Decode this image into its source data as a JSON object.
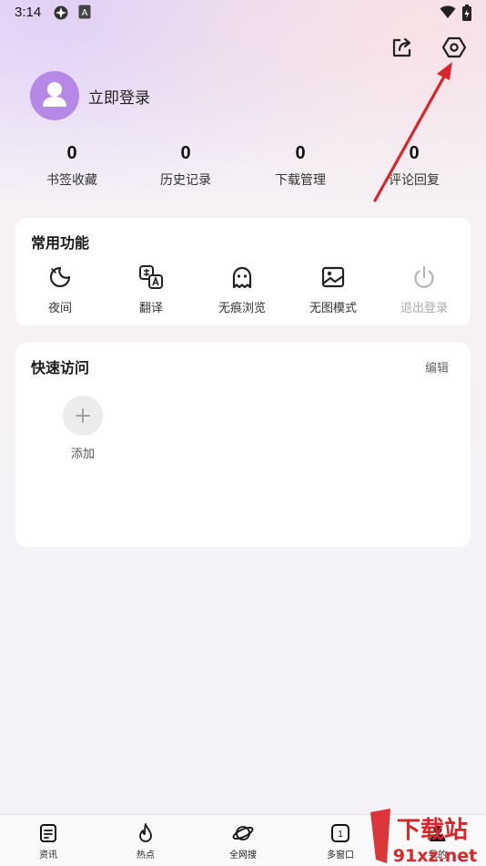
{
  "status_bar": {
    "time": "3:14",
    "icons": [
      "app-icon",
      "a-icon",
      "wifi-icon",
      "battery-icon"
    ]
  },
  "header": {
    "icons": [
      "share-icon",
      "settings-icon"
    ]
  },
  "profile": {
    "login_label": "立即登录"
  },
  "stats": [
    {
      "value": "0",
      "label": "书签收藏"
    },
    {
      "value": "0",
      "label": "历史记录"
    },
    {
      "value": "0",
      "label": "下载管理"
    },
    {
      "value": "0",
      "label": "评论回复"
    }
  ],
  "common_functions": {
    "title": "常用功能",
    "items": [
      {
        "label": "夜间",
        "icon": "moon-icon"
      },
      {
        "label": "翻译",
        "icon": "translate-icon"
      },
      {
        "label": "无痕浏览",
        "icon": "ghost-icon"
      },
      {
        "label": "无图模式",
        "icon": "image-off-icon"
      },
      {
        "label": "退出登录",
        "icon": "power-icon"
      }
    ]
  },
  "quick_access": {
    "title": "快速访问",
    "edit_label": "编辑",
    "add_label": "添加"
  },
  "bottom_nav": [
    {
      "label": "资讯",
      "icon": "news-icon"
    },
    {
      "label": "热点",
      "icon": "fire-icon"
    },
    {
      "label": "全网搜",
      "icon": "planet-icon"
    },
    {
      "label": "多窗口",
      "icon": "windows-icon",
      "badge": "1"
    },
    {
      "label": "我的",
      "icon": "profile-icon"
    }
  ],
  "watermark": {
    "brand_text": "下载站",
    "domain_text": "91xz.net"
  },
  "colors": {
    "avatar_bg": "#b789e6",
    "annotation_arrow": "#d8262a",
    "disabled_text": "#aaaaaa"
  }
}
